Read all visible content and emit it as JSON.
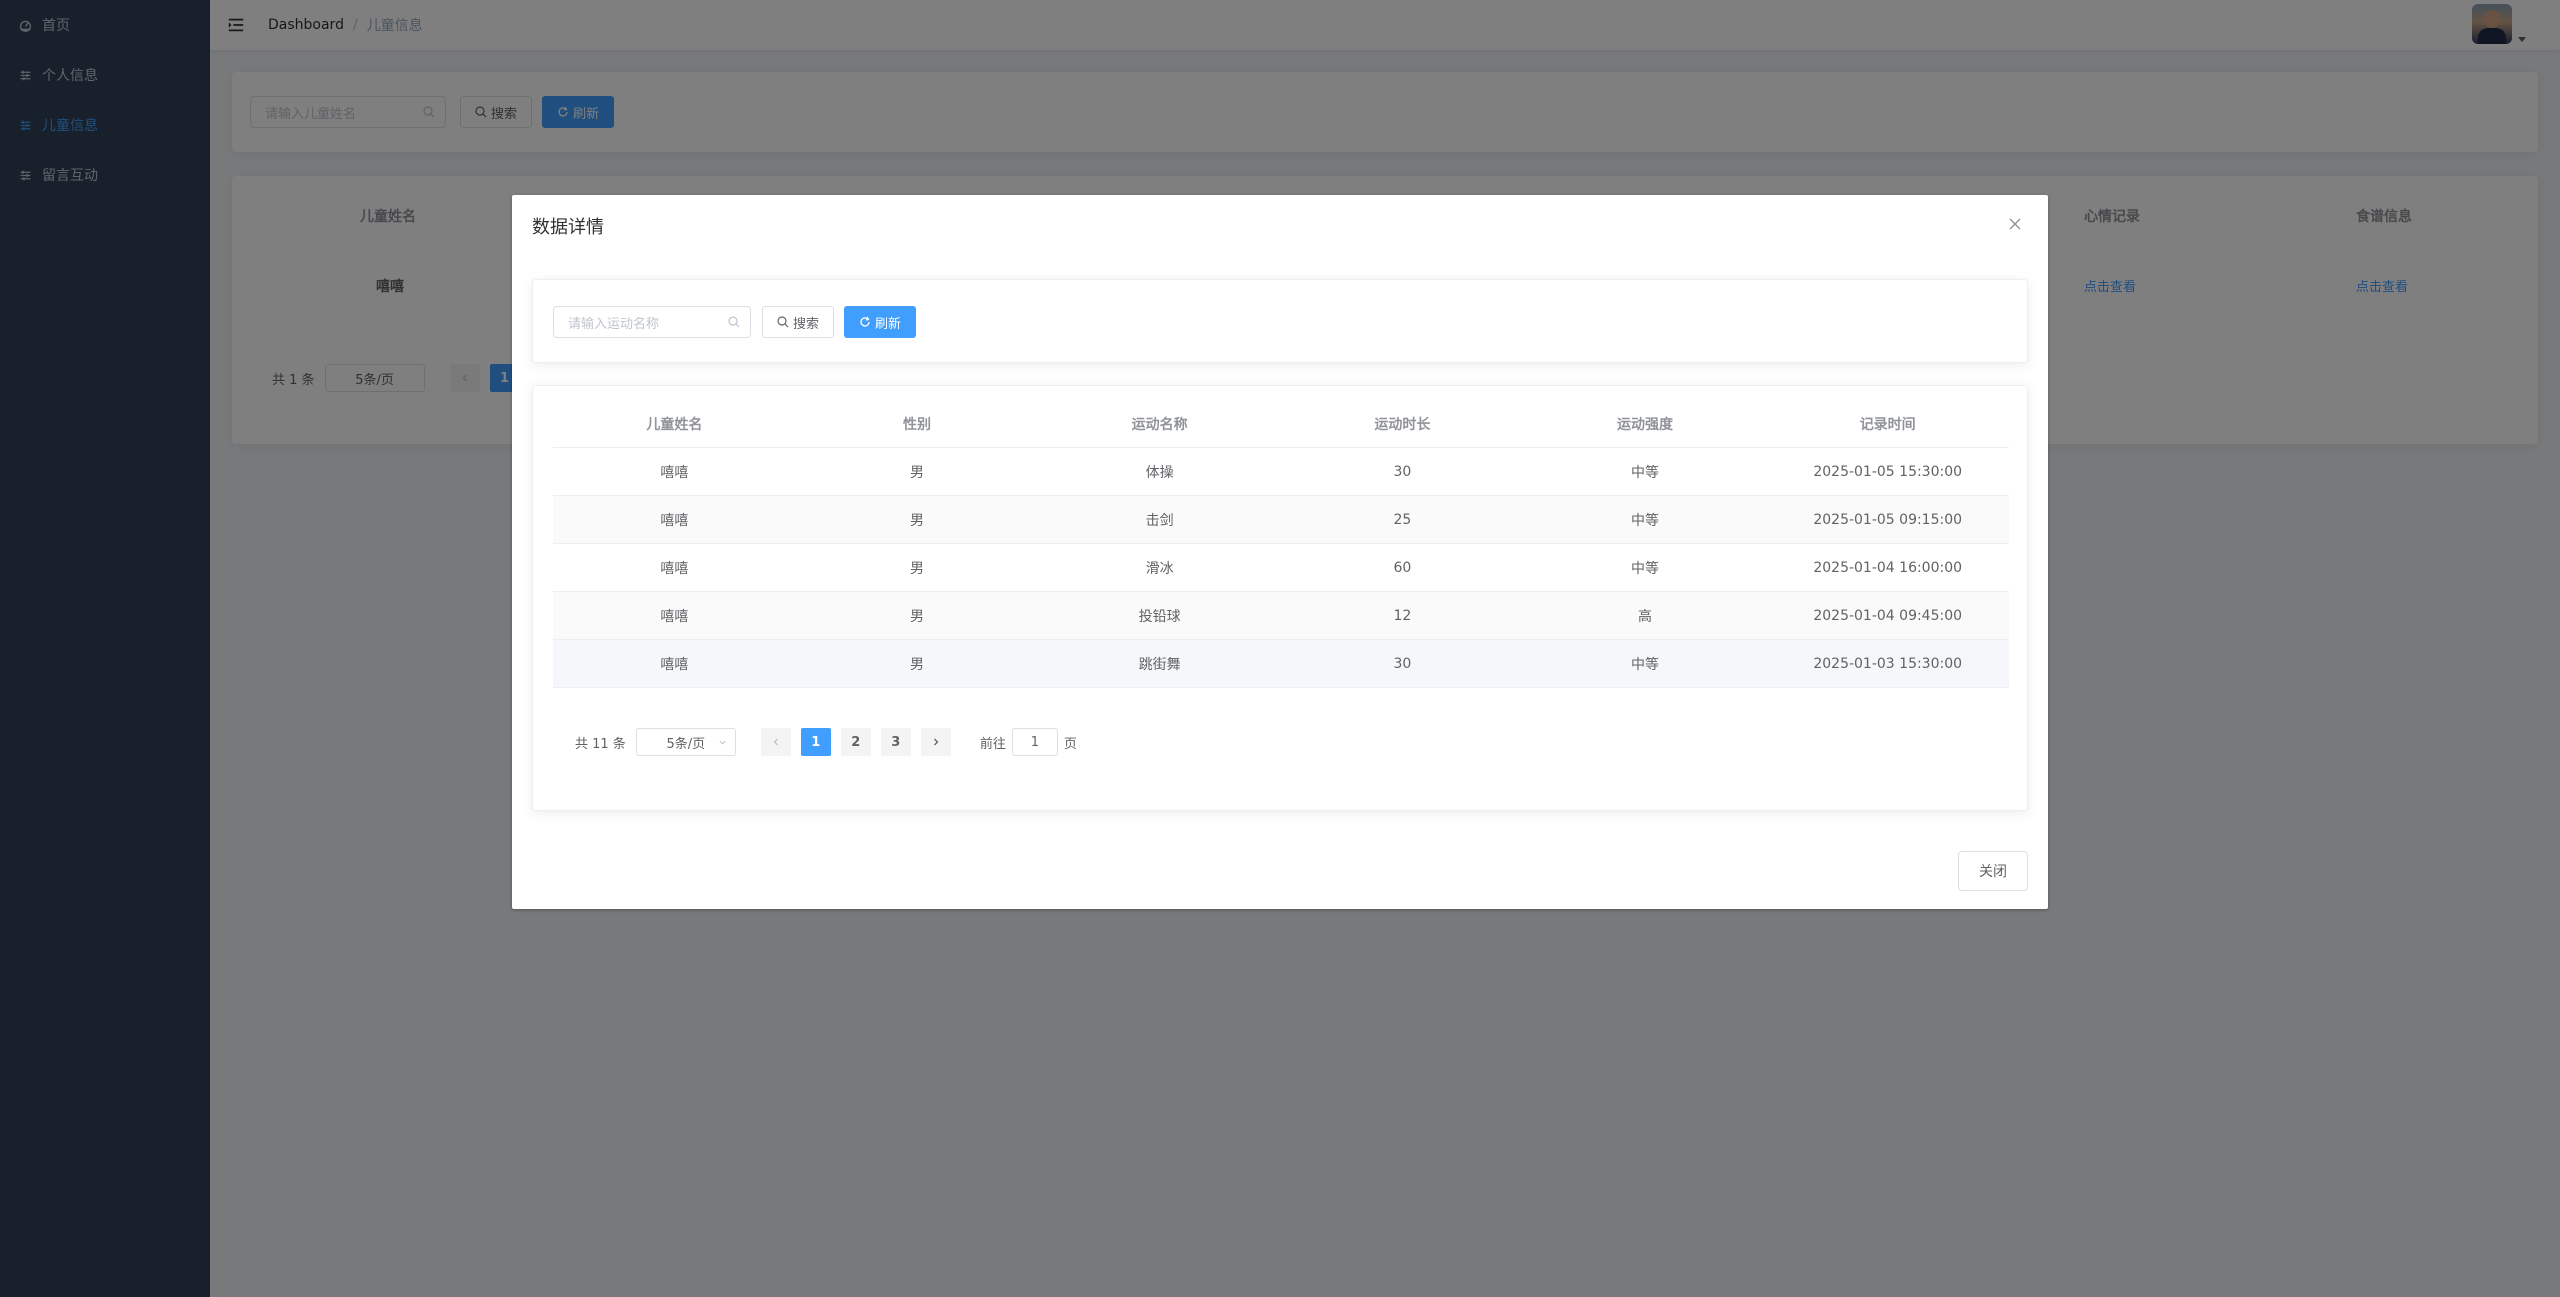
{
  "sidebar": {
    "items": [
      {
        "label": "首页",
        "icon": "dashboard-icon",
        "active": false
      },
      {
        "label": "个人信息",
        "icon": "list-icon",
        "active": false
      },
      {
        "label": "儿童信息",
        "icon": "list-icon",
        "active": true
      },
      {
        "label": "留言互动",
        "icon": "list-icon",
        "active": false
      }
    ]
  },
  "topbar": {
    "breadcrumb_home": "Dashboard",
    "breadcrumb_sep": "/",
    "breadcrumb_current": "儿童信息"
  },
  "background": {
    "search_placeholder": "请输入儿童姓名",
    "search_label": "搜索",
    "refresh_label": "刷新",
    "table_headers": {
      "name": "儿童姓名",
      "mood": "心情记录",
      "diet": "食谱信息"
    },
    "row": {
      "name": "嘻嘻",
      "mood_link": "点击查看",
      "diet_link": "点击查看"
    },
    "pager": {
      "total": "共 1 条",
      "page_size": "5条/页",
      "current_page": "1"
    }
  },
  "dialog": {
    "title": "数据详情",
    "search_placeholder": "请输入运动名称",
    "search_label": "搜索",
    "refresh_label": "刷新",
    "columns": [
      "儿童姓名",
      "性别",
      "运动名称",
      "运动时长",
      "运动强度",
      "记录时间"
    ],
    "rows": [
      [
        "嘻嘻",
        "男",
        "体操",
        "30",
        "中等",
        "2025-01-05 15:30:00"
      ],
      [
        "嘻嘻",
        "男",
        "击剑",
        "25",
        "中等",
        "2025-01-05 09:15:00"
      ],
      [
        "嘻嘻",
        "男",
        "滑冰",
        "60",
        "中等",
        "2025-01-04 16:00:00"
      ],
      [
        "嘻嘻",
        "男",
        "投铅球",
        "12",
        "高",
        "2025-01-04 09:45:00"
      ],
      [
        "嘻嘻",
        "男",
        "跳街舞",
        "30",
        "中等",
        "2025-01-03 15:30:00"
      ]
    ],
    "pager": {
      "total": "共 11 条",
      "page_size": "5条/页",
      "pages": [
        "1",
        "2",
        "3"
      ],
      "current_page": "1",
      "goto_label": "前往",
      "goto_value": "1",
      "goto_suffix": "页"
    },
    "close_label": "关闭"
  },
  "colors": {
    "primary": "#409eff",
    "sidebar_bg": "#304156",
    "sidebar_text": "#bfcbd9"
  }
}
